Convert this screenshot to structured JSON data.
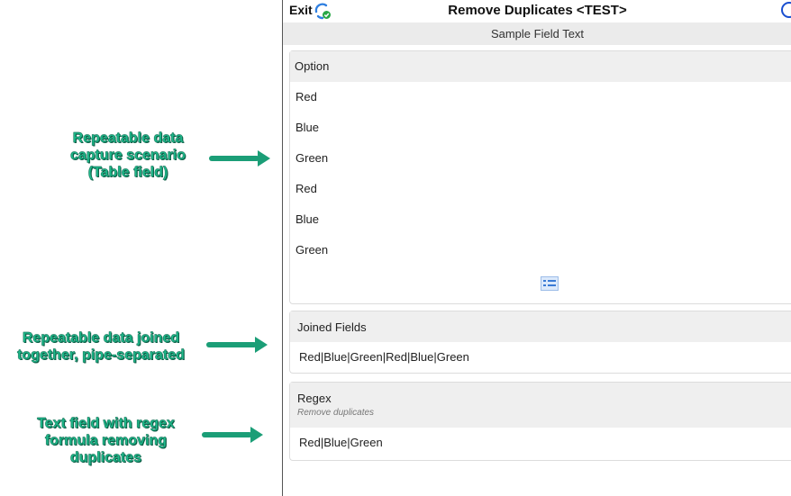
{
  "annotations": [
    {
      "lines": [
        "Repeatable data",
        "capture scenario",
        "(Table field)"
      ]
    },
    {
      "lines": [
        "Repeatable data joined",
        "together, pipe-separated"
      ]
    },
    {
      "lines": [
        "Text field with regex",
        "formula removing",
        "duplicates"
      ]
    }
  ],
  "app": {
    "exit_label": "Exit",
    "title": "Remove Duplicates <TEST>",
    "sample_field": "Sample Field Text"
  },
  "table": {
    "header": "Option",
    "rows": [
      "Red",
      "Blue",
      "Green",
      "Red",
      "Blue",
      "Green"
    ]
  },
  "joined": {
    "label": "Joined Fields",
    "value": "Red|Blue|Green|Red|Blue|Green"
  },
  "regex": {
    "label": "Regex",
    "hint": "Remove duplicates",
    "value": "Red|Blue|Green"
  },
  "colors": {
    "annotation": "#1eb88a",
    "arrow": "#1b9e77",
    "accent": "#1a4fd0"
  }
}
